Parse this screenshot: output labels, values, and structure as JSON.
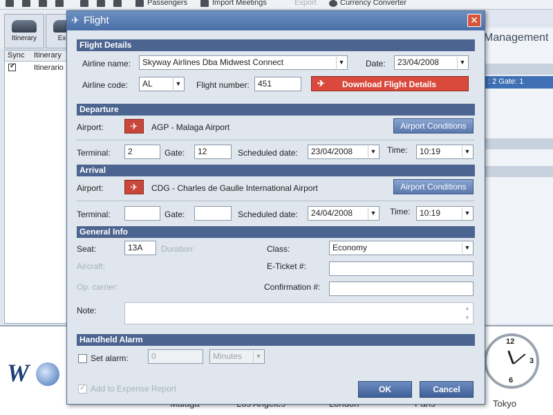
{
  "toolbar": {
    "passengers": "Passengers",
    "import_meetings": "Import Meetings",
    "export": "Export",
    "currency_converter": "Currency Converter"
  },
  "bg": {
    "tab_itinerary": "Itinerary",
    "tab_expenses": "Expe",
    "col_sync": "Sync",
    "col_itinerary": "Itinerary",
    "row_label": "Itinerario",
    "management": "Management",
    "selected_row_text": ": 2 Gate: 1",
    "cities": [
      "Malaga",
      "Los Angeles",
      "London",
      "Paris",
      "Tokyo"
    ],
    "clock_numbers": [
      "12",
      "3",
      "6"
    ]
  },
  "dialog": {
    "title": "Flight",
    "close": "✕",
    "flight_details": {
      "header": "Flight Details",
      "airline_name_label": "Airline name:",
      "airline_name": "Skyway Airlines Dba Midwest Connect",
      "date_label": "Date:",
      "date": "23/04/2008",
      "airline_code_label": "Airline code:",
      "airline_code": "AL",
      "flight_number_label": "Flight number:",
      "flight_number": "451",
      "download_label": "Download Flight Details"
    },
    "departure": {
      "header": "Departure",
      "airport_label": "Airport:",
      "airport": "AGP - Malaga Airport",
      "conditions": "Airport Conditions",
      "terminal_label": "Terminal:",
      "terminal": "2",
      "gate_label": "Gate:",
      "gate": "12",
      "sched_label": "Scheduled date:",
      "sched_date": "23/04/2008",
      "time_label": "Time:",
      "time": "10:19"
    },
    "arrival": {
      "header": "Arrival",
      "airport_label": "Airport:",
      "airport": "CDG - Charles de Gaulle International Airport",
      "conditions": "Airport Conditions",
      "terminal_label": "Terminal:",
      "terminal": "",
      "gate_label": "Gate:",
      "gate": "",
      "sched_label": "Scheduled date:",
      "sched_date": "24/04/2008",
      "time_label": "Time:",
      "time": "10:19"
    },
    "general": {
      "header": "General Info",
      "seat_label": "Seat:",
      "seat": "13A",
      "duration_label": "Duration:",
      "class_label": "Class:",
      "class": "Economy",
      "aircraft_label": "Aircraft:",
      "eticket_label": "E-Ticket #:",
      "eticket": "",
      "opcarrier_label": "Op. carrier:",
      "confirmation_label": "Confirmation #:",
      "confirmation": "",
      "note_label": "Note:",
      "note": ""
    },
    "alarm": {
      "header": "Handheld Alarm",
      "set_alarm_label": "Set alarm:",
      "amount": "0",
      "unit": "Minutes"
    },
    "expense_label": "Add to Expense Report",
    "ok": "OK",
    "cancel": "Cancel"
  },
  "colors": {
    "accent": "#4c6490",
    "danger": "#d94a3d",
    "title": "#5a7db5"
  }
}
